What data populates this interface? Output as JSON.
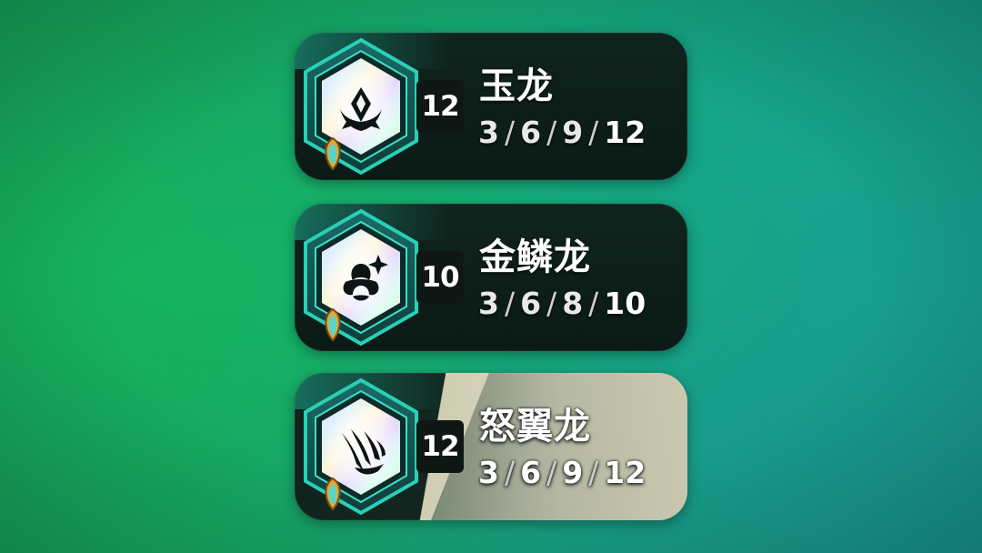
{
  "traits": [
    {
      "name": "玉龙",
      "count": "12",
      "breakpoints": [
        "3",
        "6",
        "9",
        "12"
      ],
      "icon": "jade-dragon-icon"
    },
    {
      "name": "金鳞龙",
      "count": "10",
      "breakpoints": [
        "3",
        "6",
        "8",
        "10"
      ],
      "icon": "goldscale-dragon-icon"
    },
    {
      "name": "怒翼龙",
      "count": "12",
      "breakpoints": [
        "3",
        "6",
        "9",
        "12"
      ],
      "icon": "ragewing-dragon-icon"
    }
  ],
  "colors": {
    "hex_frame": "#1fb7a0",
    "badge_gold": "#e2a83a",
    "badge_teal": "#4fd0c4",
    "card_dark": "#0b1a15",
    "card_light": "#d8d6bf"
  }
}
